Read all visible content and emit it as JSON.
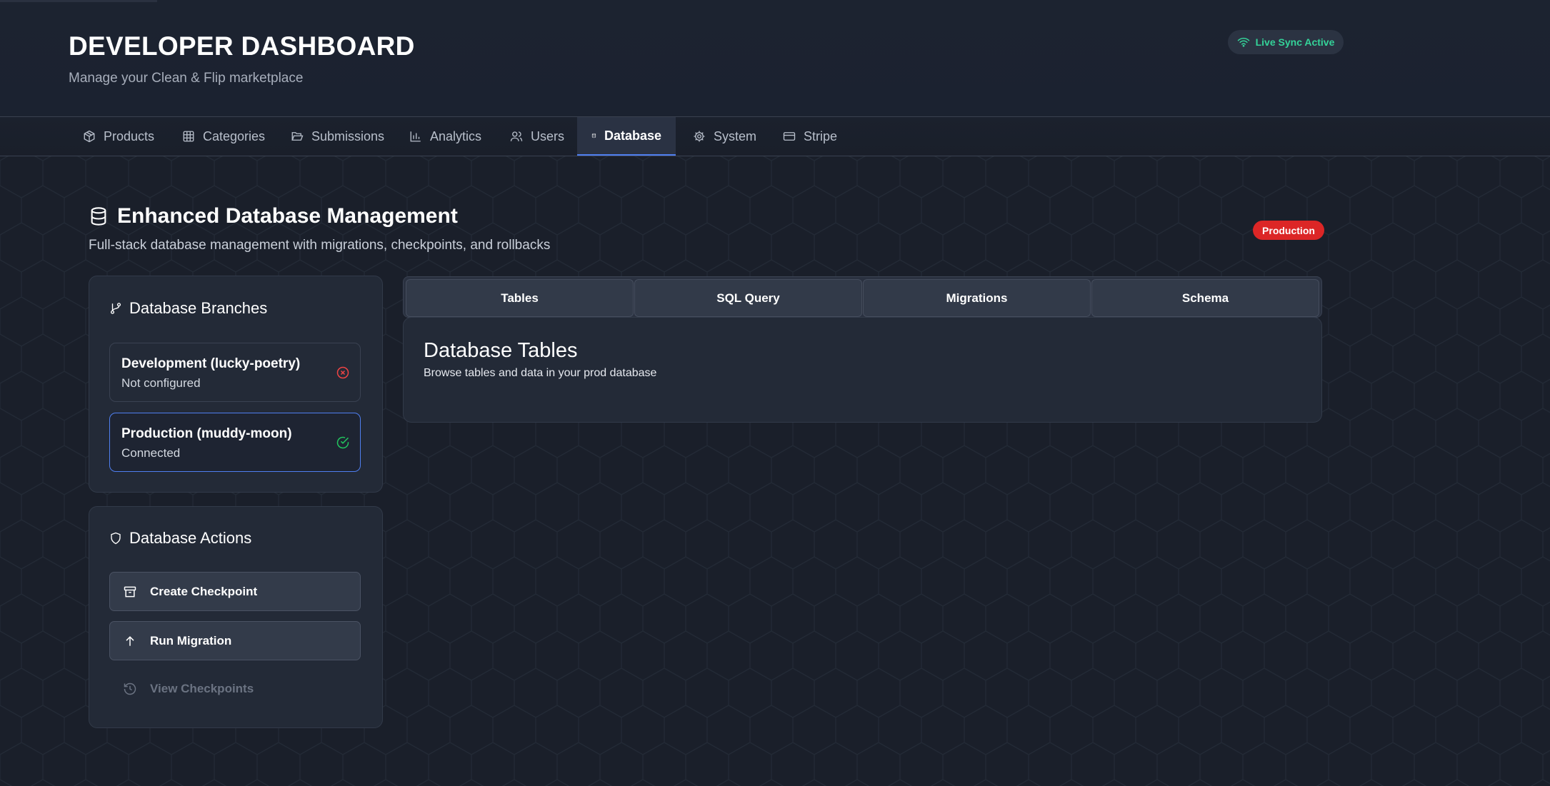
{
  "header": {
    "title": "DEVELOPER DASHBOARD",
    "subtitle": "Manage your Clean & Flip marketplace",
    "live_sync": "Live Sync Active"
  },
  "nav": {
    "tabs": [
      {
        "label": "Products",
        "icon": "box-icon"
      },
      {
        "label": "Categories",
        "icon": "grid-icon"
      },
      {
        "label": "Submissions",
        "icon": "folder-open-icon"
      },
      {
        "label": "Analytics",
        "icon": "bar-chart-icon"
      },
      {
        "label": "Users",
        "icon": "users-icon"
      },
      {
        "label": "Database",
        "icon": "database-icon",
        "active": true
      },
      {
        "label": "System",
        "icon": "gear-icon"
      },
      {
        "label": "Stripe",
        "icon": "credit-card-icon"
      }
    ]
  },
  "section": {
    "title": "Enhanced Database Management",
    "description": "Full-stack database management with migrations, checkpoints, and rollbacks",
    "env_badge": "Production"
  },
  "branches": {
    "title": "Database Branches",
    "items": [
      {
        "name": "Development (lucky-poetry)",
        "status": "Not configured",
        "state": "error"
      },
      {
        "name": "Production (muddy-moon)",
        "status": "Connected",
        "state": "ok",
        "selected": true
      }
    ]
  },
  "actions": {
    "title": "Database Actions",
    "items": [
      {
        "label": "Create Checkpoint",
        "icon": "archive-icon"
      },
      {
        "label": "Run Migration",
        "icon": "arrow-up-icon"
      },
      {
        "label": "View Checkpoints",
        "icon": "history-icon",
        "disabled": true
      }
    ]
  },
  "subtabs": {
    "items": [
      "Tables",
      "SQL Query",
      "Migrations",
      "Schema"
    ]
  },
  "tables_panel": {
    "title": "Database Tables",
    "description": "Browse tables and data in your prod database"
  },
  "colors": {
    "accent": "#4f7ff0",
    "success": "#22c55e",
    "danger": "#dc2626",
    "live": "#34d399",
    "background": "#1a1f2a"
  }
}
